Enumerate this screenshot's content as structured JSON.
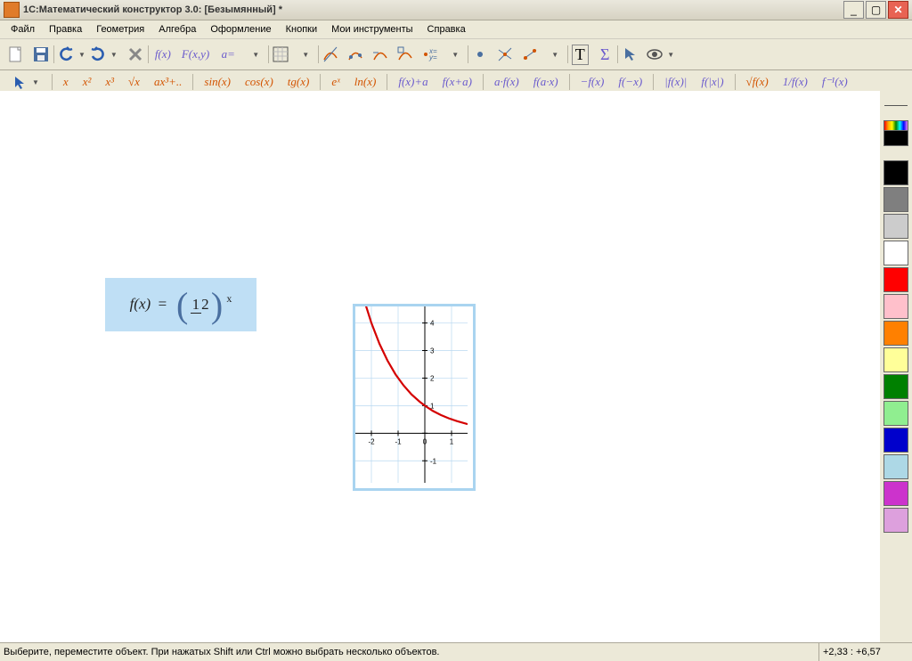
{
  "window": {
    "title": "1С:Математический конструктор 3.0: [Безымянный] *"
  },
  "menu": {
    "items": [
      "Файл",
      "Правка",
      "Геометрия",
      "Алгебра",
      "Оформление",
      "Кнопки",
      "Мои инструменты",
      "Справка"
    ]
  },
  "toolbar": {
    "fx": "f(x)",
    "Fxy": "F(x,y)",
    "aeq": "a=",
    "T": "T",
    "Sigma": "Σ"
  },
  "funcbar": {
    "group1": [
      "x",
      "x²",
      "x³",
      "√x",
      "ax³+.."
    ],
    "group2": [
      "sin(x)",
      "cos(x)",
      "tg(x)"
    ],
    "group3": [
      "eˣ",
      "ln(x)"
    ],
    "group4": [
      "f(x)+a",
      "f(x+a)"
    ],
    "group5": [
      "a·f(x)",
      "f(a·x)"
    ],
    "group6": [
      "−f(x)",
      "f(−x)"
    ],
    "group7": [
      "|f(x)|",
      "f(|x|)"
    ],
    "group8": [
      "√f(x)",
      "1/f(x)",
      "f⁻¹(x)"
    ]
  },
  "formula": {
    "lhs": "f(x)",
    "eq": "=",
    "frac_num": "1",
    "frac_den": "2",
    "exp": "x"
  },
  "chart_data": {
    "type": "line",
    "title": "",
    "xlabel": "",
    "ylabel": "",
    "xlim": [
      -2.6,
      1.6
    ],
    "ylim": [
      -1.8,
      4.6
    ],
    "xticks": [
      -2,
      -1,
      0,
      1
    ],
    "yticks": [
      -1,
      1,
      2,
      3,
      4
    ],
    "series": [
      {
        "name": "(1/2)^x",
        "color": "#d40000",
        "x": [
          -2.55,
          -2.3,
          -2,
          -1.7,
          -1.4,
          -1.1,
          -0.8,
          -0.5,
          -0.2,
          0,
          0.3,
          0.6,
          0.9,
          1.2,
          1.6
        ],
        "y": [
          5.86,
          4.92,
          4,
          3.25,
          2.64,
          2.14,
          1.74,
          1.41,
          1.15,
          1,
          0.81,
          0.66,
          0.54,
          0.44,
          0.33
        ]
      }
    ]
  },
  "palette": {
    "colors": [
      "#000000",
      "#7f7f7f",
      "#cccccc",
      "#ffffff",
      "#ff0000",
      "#ffc0cb",
      "#ff8000",
      "#ffff99",
      "#008000",
      "#90ee90",
      "#0000cc",
      "#add8e6",
      "#cc33cc",
      "#dda0dd"
    ]
  },
  "status": {
    "hint": "Выберите, переместите объект. При нажатых Shift или Ctrl можно выбрать несколько объектов.",
    "coords": "+2,33 : +6,57"
  }
}
